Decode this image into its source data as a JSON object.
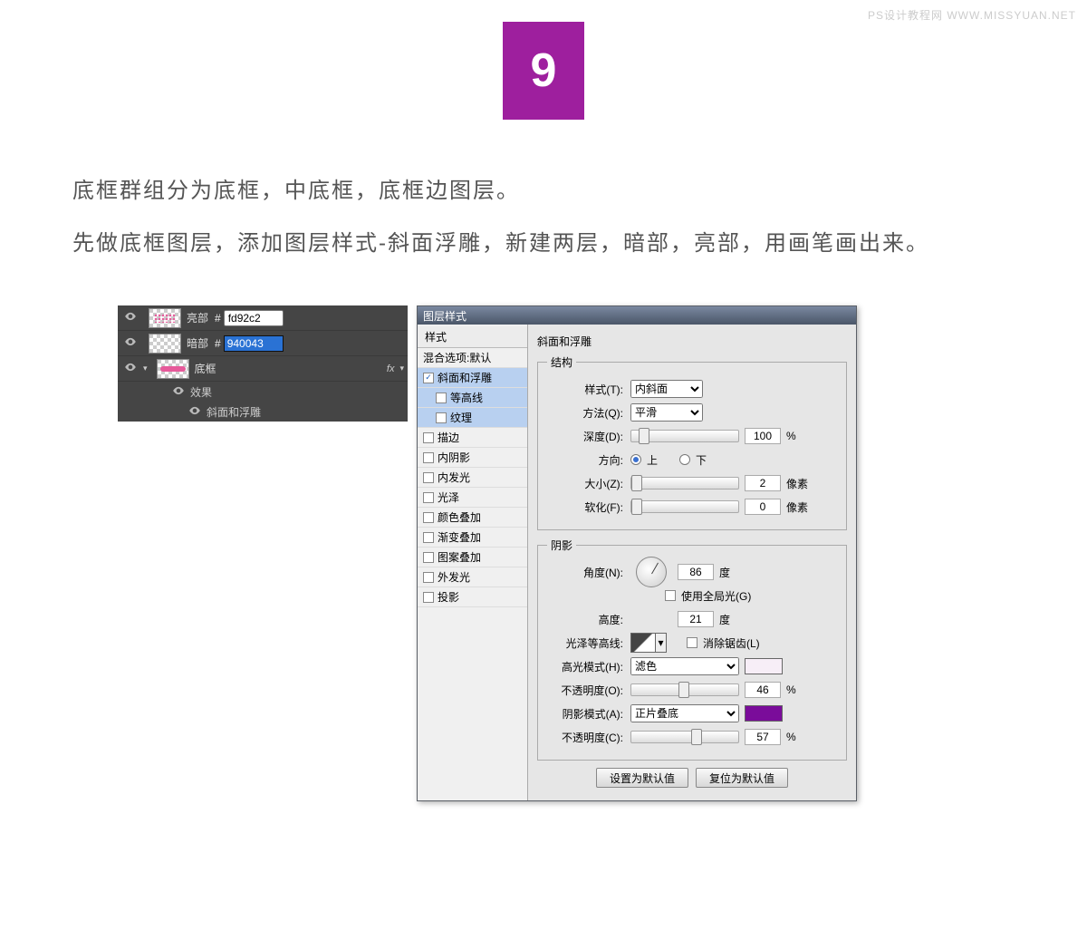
{
  "watermark": "PS设计教程网  WWW.MISSYUAN.NET",
  "step_number": "9",
  "instructions": {
    "line1": "底框群组分为底框，中底框，底框边图层。",
    "line2": "先做底框图层，添加图层样式-斜面浮雕，新建两层，暗部，亮部，用画笔画出来。"
  },
  "layers_panel": {
    "rows": [
      {
        "name": "亮部",
        "hex": "fd92c2",
        "selected": false
      },
      {
        "name": "暗部",
        "hex": "940043",
        "selected": true
      },
      {
        "name": "底框",
        "fx": "fx"
      }
    ],
    "effects_label": "效果",
    "bevel_label": "斜面和浮雕"
  },
  "dialog": {
    "title": "图层样式",
    "styles_header": "样式",
    "blend_options": "混合选项:默认",
    "items": {
      "bevel": "斜面和浮雕",
      "contour": "等高线",
      "texture": "纹理",
      "stroke": "描边",
      "inner_shadow": "内阴影",
      "inner_glow": "内发光",
      "satin": "光泽",
      "color_overlay": "颜色叠加",
      "gradient_overlay": "渐变叠加",
      "pattern_overlay": "图案叠加",
      "outer_glow": "外发光",
      "drop_shadow": "投影"
    },
    "section_title": "斜面和浮雕",
    "structure_legend": "结构",
    "shadow_legend": "阴影",
    "labels": {
      "style": "样式(T):",
      "method": "方法(Q):",
      "depth": "深度(D):",
      "direction": "方向:",
      "up": "上",
      "down": "下",
      "size": "大小(Z):",
      "soften": "软化(F):",
      "angle": "角度(N):",
      "use_global": "使用全局光(G)",
      "altitude": "高度:",
      "gloss_contour": "光泽等高线:",
      "antialias": "消除锯齿(L)",
      "highlight_mode": "高光模式(H):",
      "opacity1": "不透明度(O):",
      "shadow_mode": "阴影模式(A):",
      "opacity2": "不透明度(C):",
      "percent": "%",
      "px": "像素",
      "deg": "度"
    },
    "values": {
      "style": "内斜面",
      "method": "平滑",
      "depth": "100",
      "size": "2",
      "soften": "0",
      "angle": "86",
      "altitude": "21",
      "highlight_mode": "滤色",
      "opacity1": "46",
      "shadow_mode": "正片叠底",
      "opacity2": "57"
    },
    "buttons": {
      "set_default": "设置为默认值",
      "reset_default": "复位为默认值"
    }
  }
}
